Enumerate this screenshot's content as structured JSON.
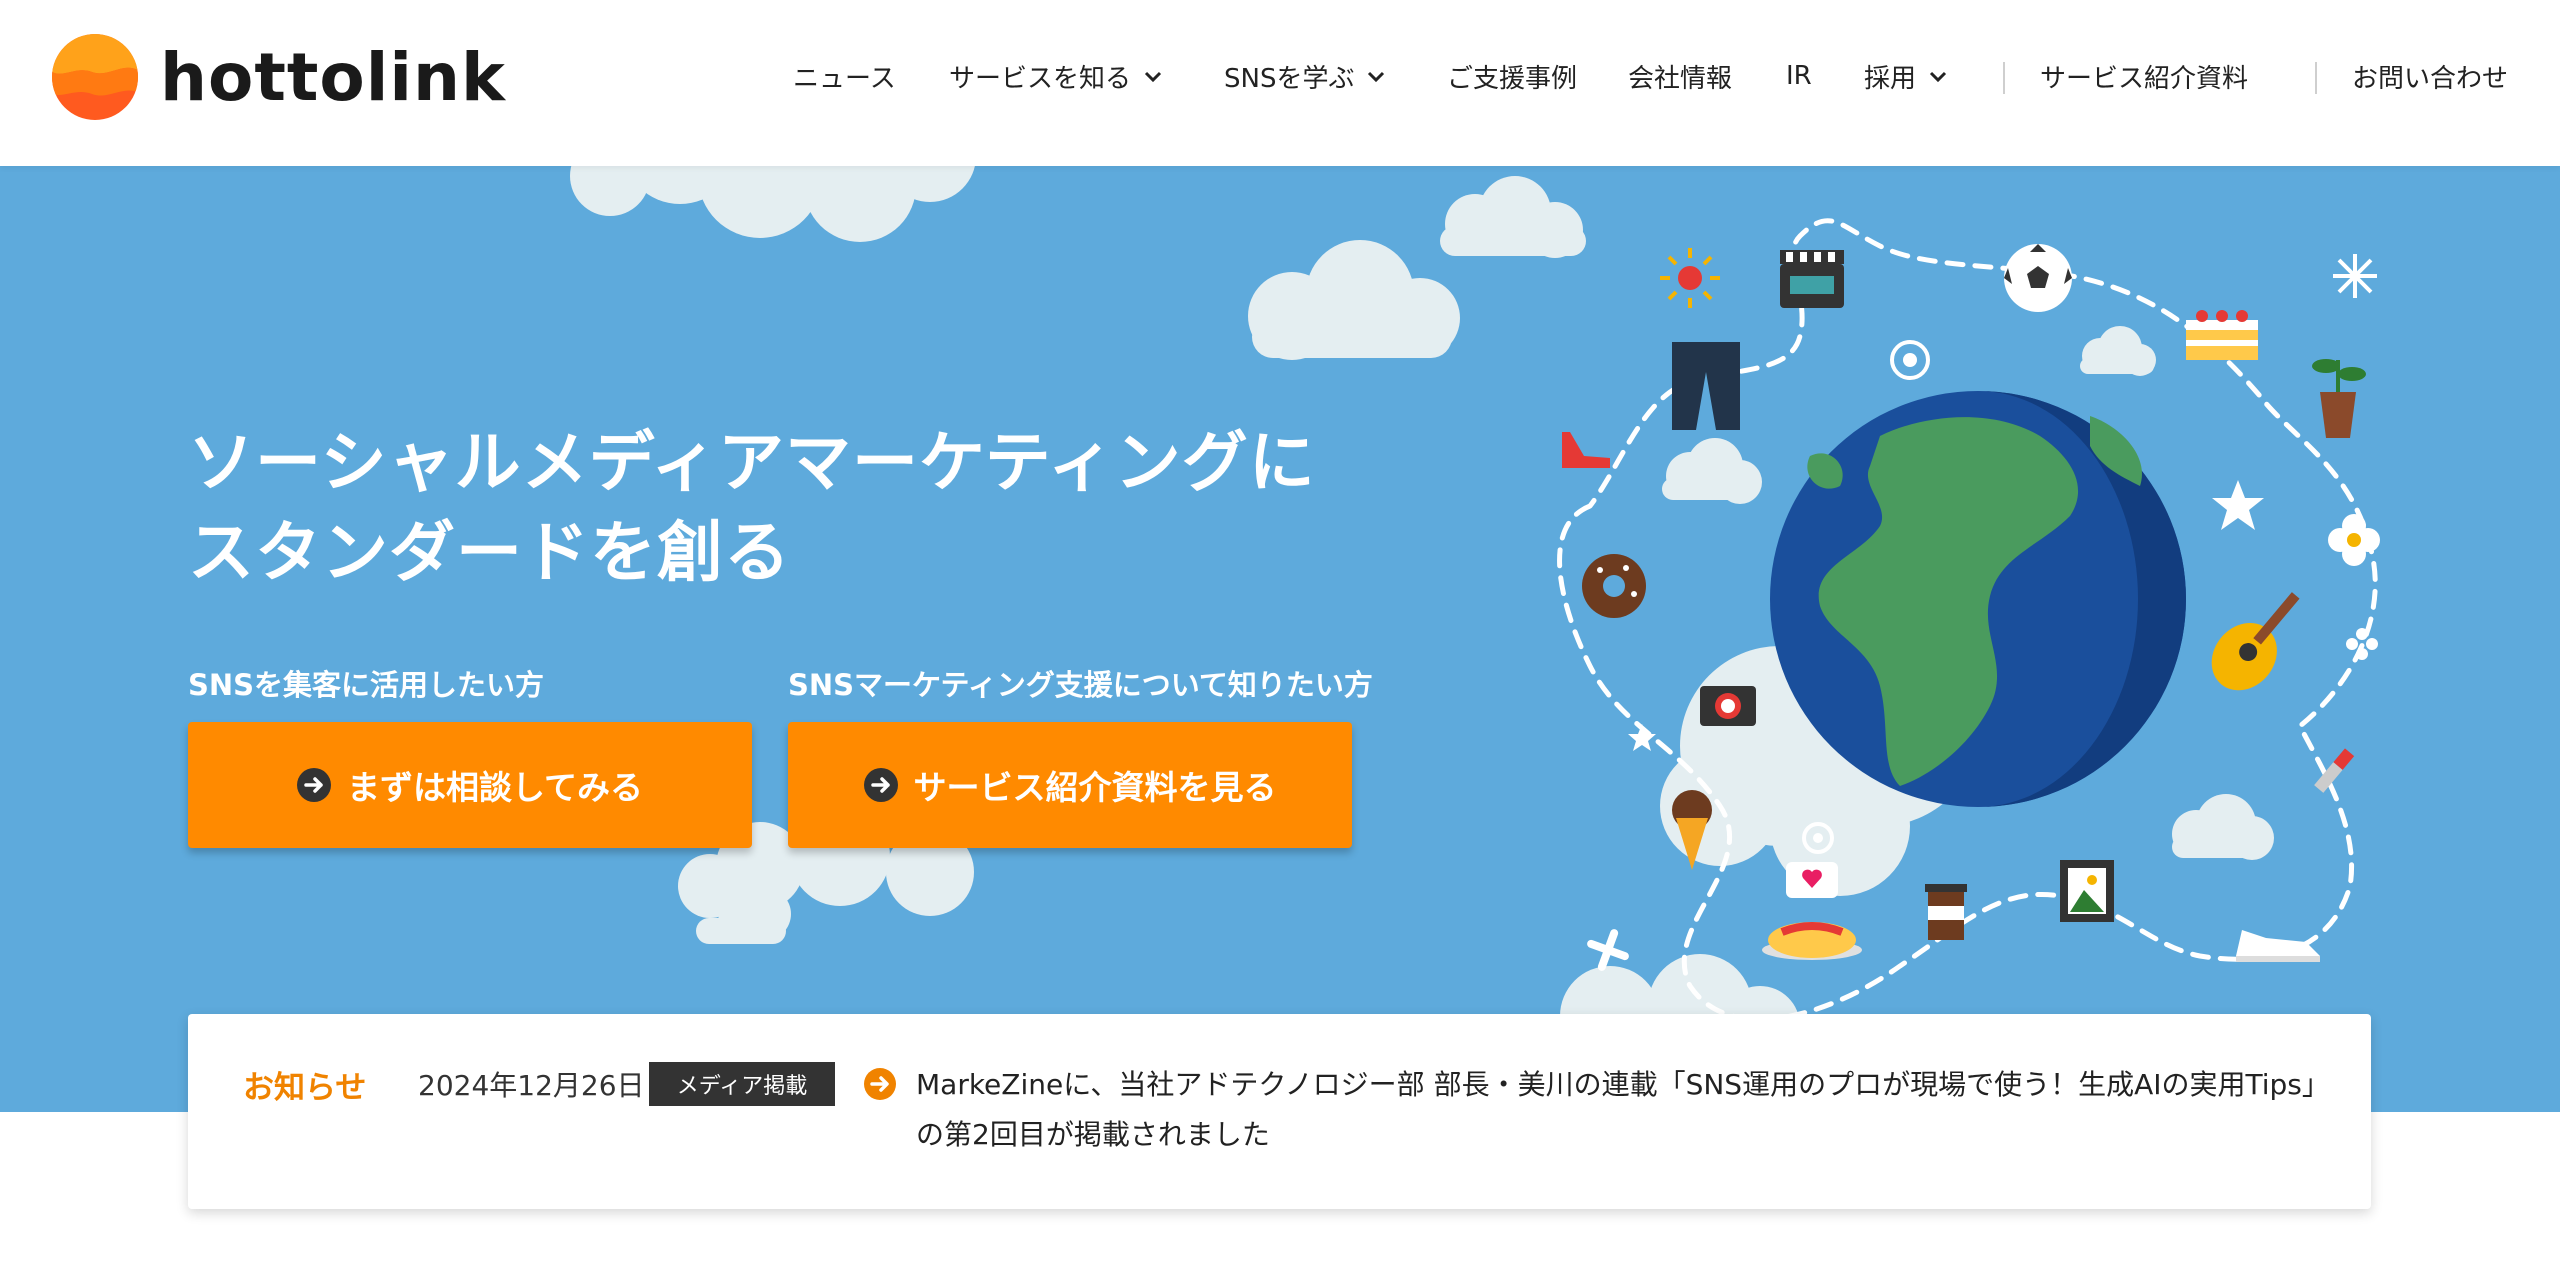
{
  "brand": {
    "name": "hottolink"
  },
  "nav": {
    "items": [
      {
        "label": "ニュース",
        "dropdown": false
      },
      {
        "label": "サービスを知る",
        "dropdown": true
      },
      {
        "label": "SNSを学ぶ",
        "dropdown": true
      },
      {
        "label": "ご支援事例",
        "dropdown": false
      },
      {
        "label": "会社情報",
        "dropdown": false
      },
      {
        "label": "IR",
        "dropdown": false
      },
      {
        "label": "採用",
        "dropdown": true
      },
      {
        "label": "サービス紹介資料",
        "dropdown": false
      },
      {
        "label": "お問い合わせ",
        "dropdown": false
      }
    ]
  },
  "hero": {
    "headline_line1": "ソーシャルメディアマーケティングに",
    "headline_line2": "スタンダードを創る",
    "cta_primary": {
      "caption": "SNSを集客に活用したい方",
      "label": "まずは相談してみる"
    },
    "cta_secondary": {
      "caption": "SNSマーケティング支援について知りたい方",
      "label": "サービス紹介資料を見る"
    }
  },
  "news": {
    "section_label": "お知らせ",
    "date": "2024年12月26日",
    "category": "メディア掲載",
    "headline": "MarkeZineに、当社アドテクノロジー部 部長・美川の連載「SNS運用のプロが現場で使う！生成AIの実用Tips」の第2回目が掲載されました"
  },
  "colors": {
    "brand_orange": "#ff8a00",
    "hero_sky": "#5eaadc",
    "news_label": "#f08300",
    "badge_bg": "#333333"
  },
  "icons": [
    "chevron-down-icon",
    "arrow-right-circle-icon",
    "logo-icon"
  ]
}
